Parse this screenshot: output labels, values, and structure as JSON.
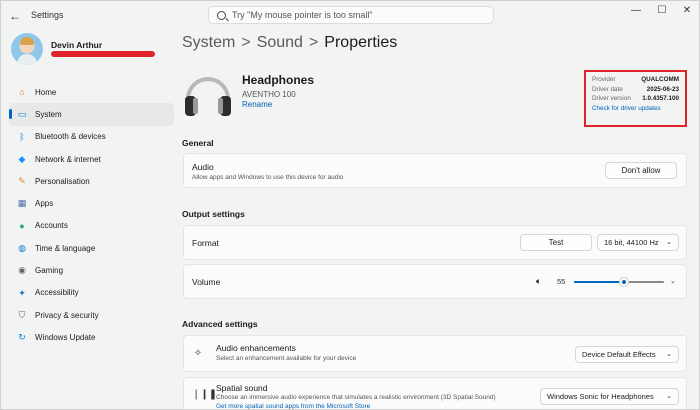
{
  "window": {
    "title": "Settings"
  },
  "search": {
    "placeholder": "Try \"My mouse pointer is too small\""
  },
  "profile": {
    "name": "Devin Arthur"
  },
  "sidebar": {
    "items": [
      {
        "label": "Home",
        "icon": "home-icon",
        "glyph": "⌂",
        "color": "#e07b39"
      },
      {
        "label": "System",
        "icon": "system-icon",
        "glyph": "▭",
        "color": "#0a7fd4",
        "active": true
      },
      {
        "label": "Bluetooth & devices",
        "icon": "bluetooth-icon",
        "glyph": "ᛒ",
        "color": "#0a7fd4"
      },
      {
        "label": "Network & internet",
        "icon": "network-icon",
        "glyph": "◆",
        "color": "#1e90ff"
      },
      {
        "label": "Personalisation",
        "icon": "brush-icon",
        "glyph": "✎",
        "color": "#e0872b"
      },
      {
        "label": "Apps",
        "icon": "apps-icon",
        "glyph": "▦",
        "color": "#4a6fa5"
      },
      {
        "label": "Accounts",
        "icon": "accounts-icon",
        "glyph": "●",
        "color": "#2fa36b"
      },
      {
        "label": "Time & language",
        "icon": "globe-icon",
        "glyph": "◍",
        "color": "#0a7fd4"
      },
      {
        "label": "Gaming",
        "icon": "gamepad-icon",
        "glyph": "◉",
        "color": "#666666"
      },
      {
        "label": "Accessibility",
        "icon": "accessibility-icon",
        "glyph": "✦",
        "color": "#1a73c9"
      },
      {
        "label": "Privacy & security",
        "icon": "shield-icon",
        "glyph": "⛉",
        "color": "#666666"
      },
      {
        "label": "Windows Update",
        "icon": "update-icon",
        "glyph": "↻",
        "color": "#0a7fd4"
      }
    ]
  },
  "breadcrumb": {
    "part1": "System",
    "part2": "Sound",
    "current": "Properties",
    "separator": ">"
  },
  "device": {
    "name": "Headphones",
    "model": "AVENTHO 100",
    "rename": "Rename"
  },
  "driver": {
    "provider_label": "Provider",
    "provider_value": "QUALCOMM",
    "date_label": "Driver date",
    "date_value": "2025-06-23",
    "version_label": "Driver version",
    "version_value": "1.0.4357.100",
    "check_link": "Check for driver updates"
  },
  "sections": {
    "general": "General",
    "output": "Output settings",
    "advanced": "Advanced settings"
  },
  "audio": {
    "title": "Audio",
    "desc": "Allow apps and Windows to use this device for audio",
    "button": "Don't allow"
  },
  "format": {
    "title": "Format",
    "test_button": "Test",
    "value": "16 bit, 44100 Hz"
  },
  "volume": {
    "title": "Volume",
    "value": "55",
    "level": 55
  },
  "enhancements": {
    "title": "Audio enhancements",
    "desc": "Select an enhancement available for your device",
    "value": "Device Default Effects"
  },
  "spatial": {
    "title": "Spatial sound",
    "desc": "Choose an immersive audio experience that simulates a realistic environment (3D Spatial Sound)",
    "link": "Get more spatial sound apps from the Microsoft Store",
    "value": "Windows Sonic for Headphones"
  },
  "colors": {
    "accent": "#0067c0",
    "highlight": "#e0242b"
  }
}
